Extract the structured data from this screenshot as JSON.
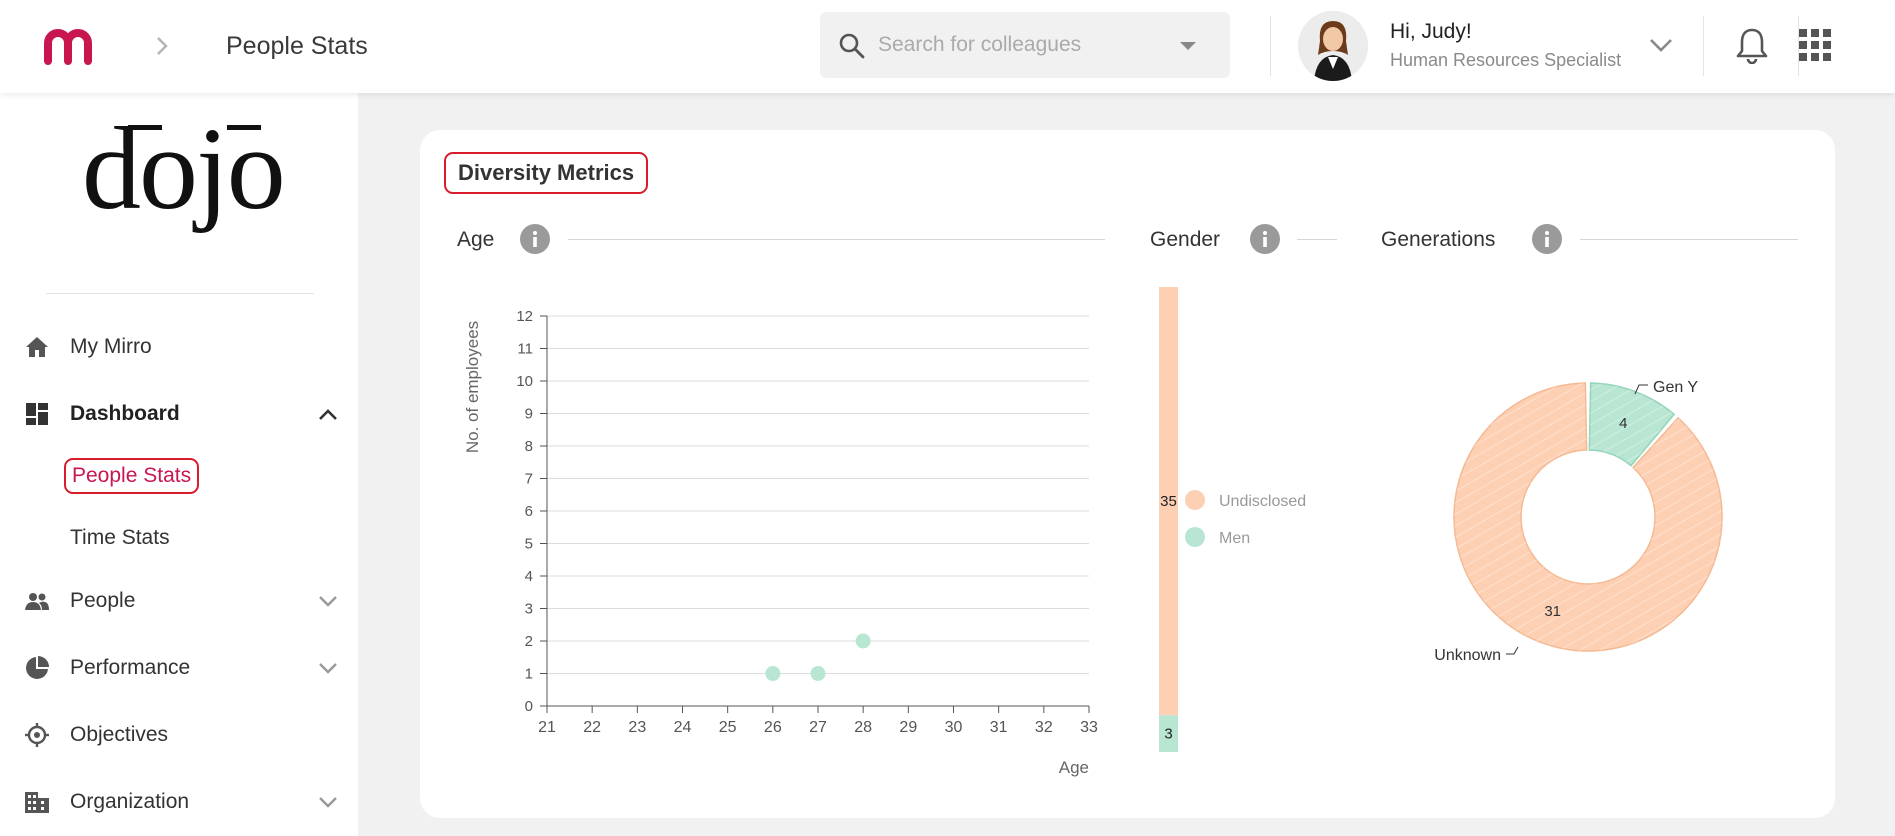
{
  "topbar": {
    "page_title": "People Stats",
    "search_placeholder": "Search for colleagues",
    "greeting": "Hi, Judy!",
    "role": "Human Resources Specialist"
  },
  "sidebar": {
    "brand": "dojo",
    "items": [
      {
        "label": "My Mirro",
        "icon": "home-icon"
      },
      {
        "label": "Dashboard",
        "icon": "dashboard-icon",
        "expanded": true,
        "children": [
          {
            "label": "People Stats",
            "active": true
          },
          {
            "label": "Time Stats"
          }
        ]
      },
      {
        "label": "People",
        "icon": "people-icon"
      },
      {
        "label": "Performance",
        "icon": "pie-chart-icon"
      },
      {
        "label": "Objectives",
        "icon": "target-icon"
      },
      {
        "label": "Organization",
        "icon": "building-icon"
      }
    ]
  },
  "card": {
    "title": "Diversity Metrics",
    "sections": {
      "age": "Age",
      "gender": "Gender",
      "generations": "Generations"
    }
  },
  "colors": {
    "accent": "#c8174f",
    "peach": "#fdd0b4",
    "mint": "#b8e6d2"
  },
  "chart_data": [
    {
      "type": "scatter",
      "title": "Age",
      "xlabel": "Age",
      "ylabel": "No. of employees",
      "xlim": [
        21,
        33
      ],
      "ylim": [
        0,
        12
      ],
      "x_ticks": [
        21,
        22,
        23,
        24,
        25,
        26,
        27,
        28,
        29,
        30,
        31,
        32,
        33
      ],
      "y_ticks": [
        0,
        1,
        2,
        3,
        4,
        5,
        6,
        7,
        8,
        9,
        10,
        11,
        12
      ],
      "grid": true,
      "points": [
        {
          "x": 26,
          "y": 1
        },
        {
          "x": 27,
          "y": 1
        },
        {
          "x": 28,
          "y": 2
        }
      ]
    },
    {
      "type": "bar",
      "title": "Gender",
      "stacked": true,
      "legend": "right",
      "series": [
        {
          "name": "Undisclosed",
          "value": 35,
          "color": "#fdd0b4"
        },
        {
          "name": "Men",
          "value": 3,
          "color": "#b8e6d2"
        }
      ]
    },
    {
      "type": "pie",
      "title": "Generations",
      "donut": true,
      "slices": [
        {
          "name": "Gen Y",
          "value": 4,
          "color": "#b8e6d2"
        },
        {
          "name": "Unknown",
          "value": 31,
          "color": "#fdd0b4"
        }
      ]
    }
  ]
}
